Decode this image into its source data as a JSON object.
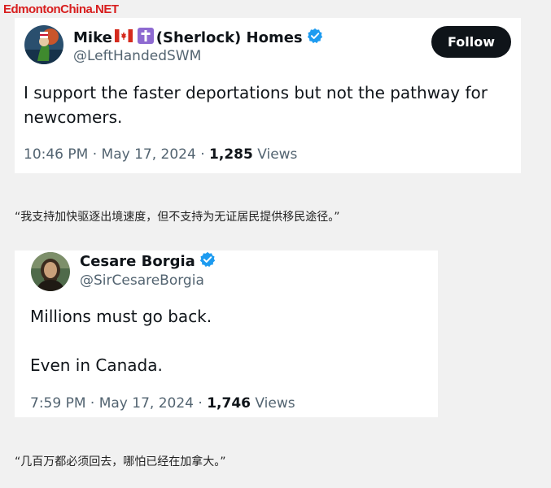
{
  "watermark": "EdmontonChina.NET",
  "tweets": [
    {
      "name_prefix": "Mike",
      "name_suffix": "(Sherlock) Homes",
      "handle": "@LeftHandedSWM",
      "follow_label": "Follow",
      "text": "I support the faster deportations but not the pathway for newcomers.",
      "time": "10:46 PM",
      "date": "May 17, 2024",
      "views_count": "1,285",
      "views_label": "Views",
      "flag_icons": [
        "canada-flag-icon",
        "cross-icon"
      ]
    },
    {
      "name": "Cesare Borgia",
      "handle": "@SirCesareBorgia",
      "text_line1": "Millions must go back.",
      "text_line2": "Even in Canada.",
      "time": "7:59 PM",
      "date": "May 17, 2024",
      "views_count": "1,746",
      "views_label": "Views"
    }
  ],
  "captions": [
    "“我支持加快驱逐出境速度，但不支持为无证居民提供移民途径。”",
    "“几百万都必须回去，哪怕已经在加拿大。”"
  ],
  "separator": " · ",
  "colors": {
    "verified": "#1d9bf0",
    "follow_bg": "#0f1419",
    "secondary_text": "#536471",
    "watermark": "#d81e1e"
  }
}
